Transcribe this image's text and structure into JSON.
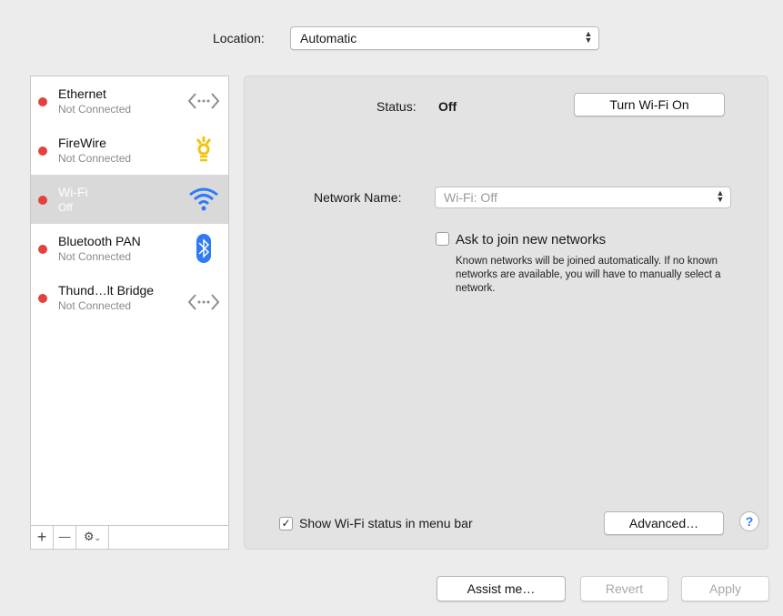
{
  "location": {
    "label": "Location:",
    "value": "Automatic"
  },
  "services": [
    {
      "name": "Ethernet",
      "status": "Not Connected",
      "icon": "ethernet-icon",
      "selected": false
    },
    {
      "name": "FireWire",
      "status": "Not Connected",
      "icon": "firewire-icon",
      "selected": false
    },
    {
      "name": "Wi-Fi",
      "status": "Off",
      "icon": "wifi-icon",
      "selected": true
    },
    {
      "name": "Bluetooth PAN",
      "status": "Not Connected",
      "icon": "bluetooth-icon",
      "selected": false
    },
    {
      "name": "Thund…lt Bridge",
      "status": "Not Connected",
      "icon": "thunderbolt-bridge-icon",
      "selected": false
    }
  ],
  "sidebar_footer": {
    "add": "+",
    "remove": "—"
  },
  "panel": {
    "status_label": "Status:",
    "status_value": "Off",
    "turn_on_button": "Turn Wi-Fi On",
    "network_name_label": "Network Name:",
    "network_name_value": "Wi-Fi: Off",
    "ask_join_label": "Ask to join new networks",
    "ask_join_checked": false,
    "ask_join_help": "Known networks will be joined automatically. If no known networks are available, you will have to manually select a network.",
    "show_status_label": "Show Wi-Fi status in menu bar",
    "show_status_checked": true,
    "advanced_button": "Advanced…",
    "help_button": "?"
  },
  "bottom": {
    "assist": "Assist me…",
    "revert": "Revert",
    "apply": "Apply"
  },
  "colors": {
    "status_dot": "#e2413f",
    "selected_row": "#d9d9d9",
    "wifi_blue": "#2f7bf5",
    "firewire_yellow": "#f1c40f"
  }
}
